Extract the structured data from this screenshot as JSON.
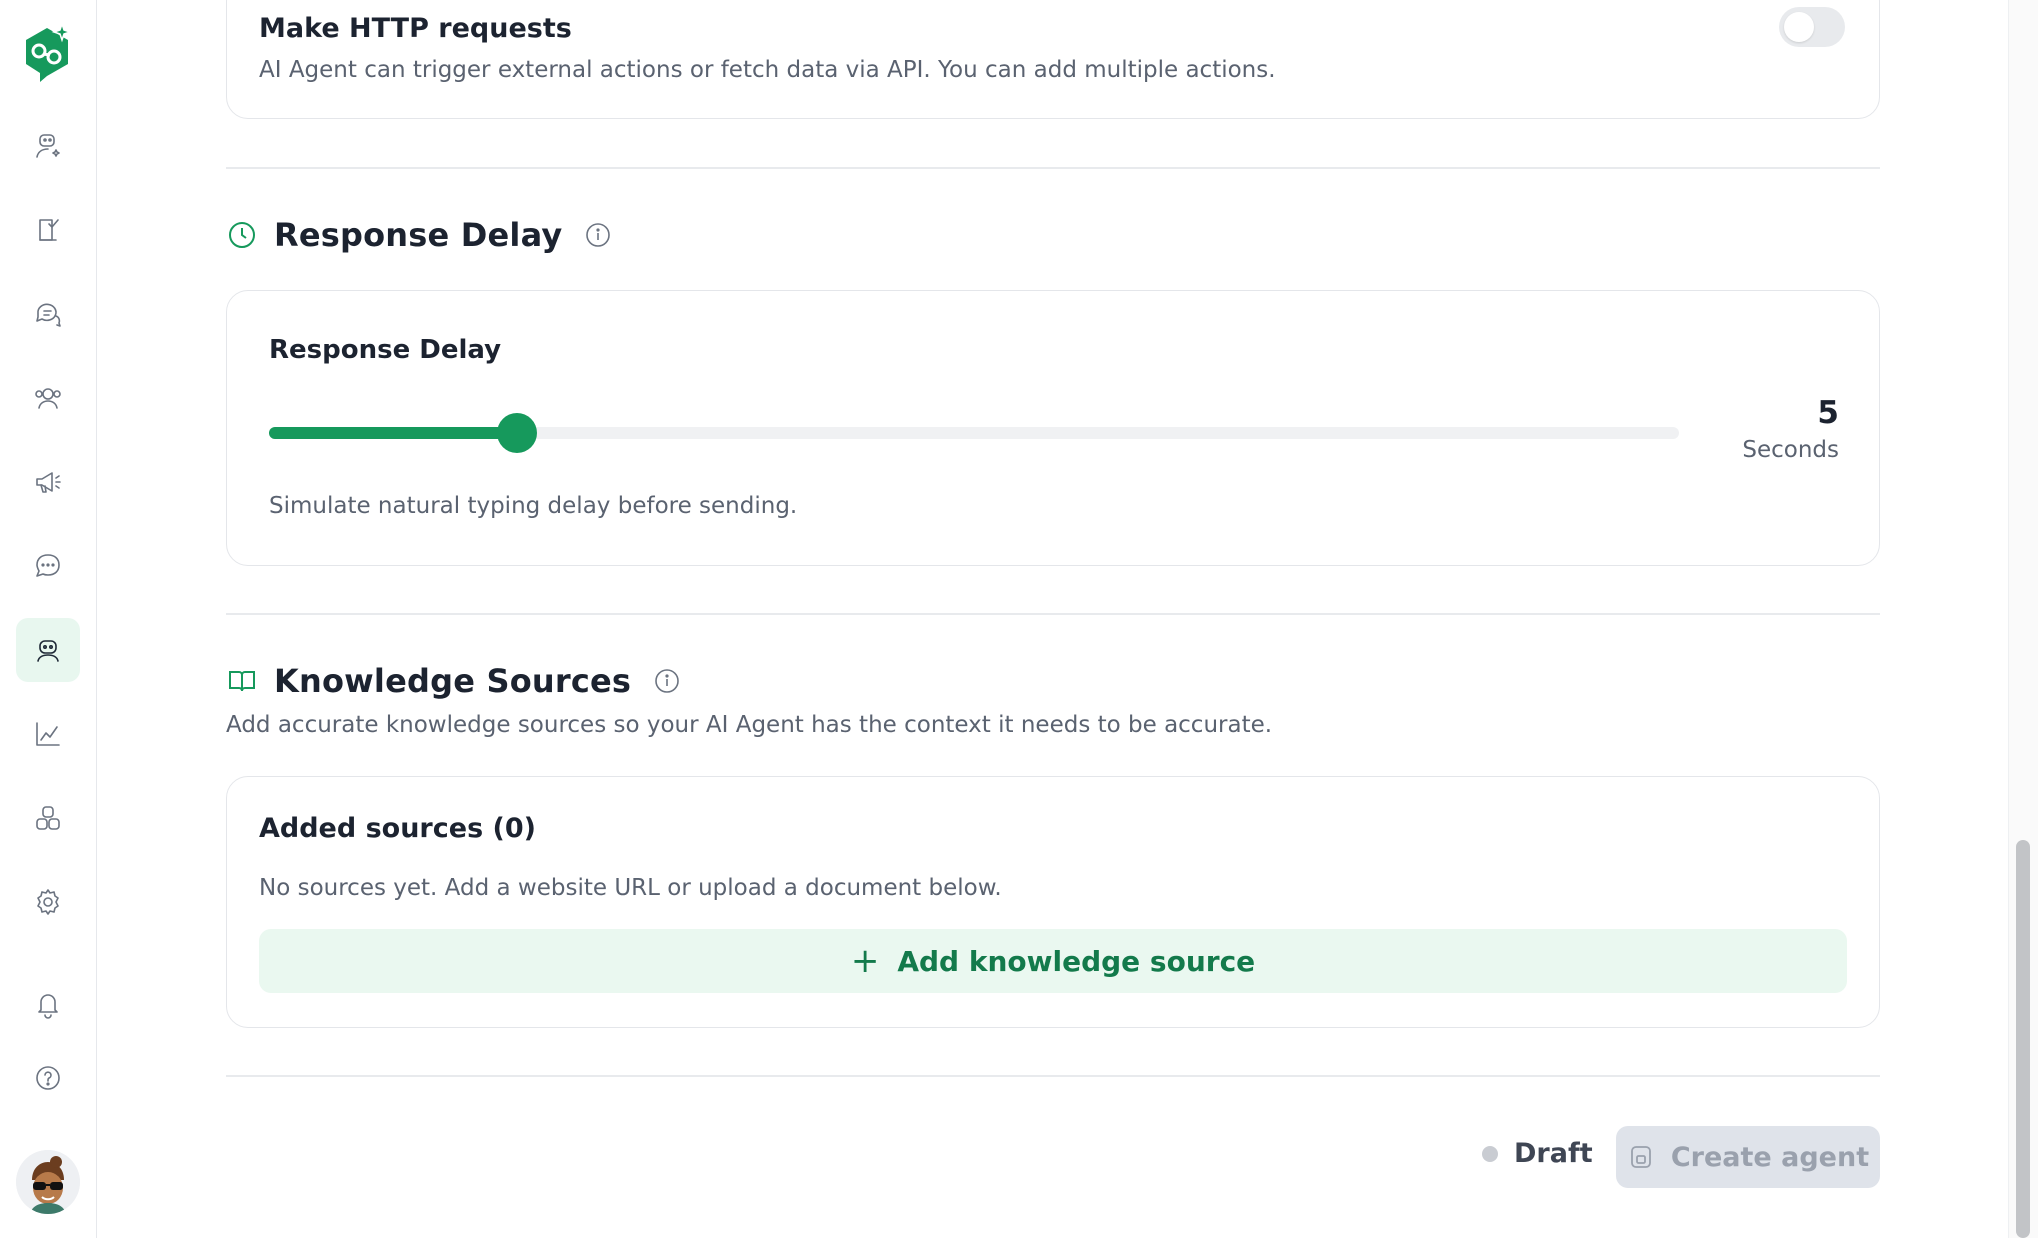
{
  "sidebar": {
    "logo": "agent-logo",
    "items": [
      {
        "name": "contacts-ai",
        "icon": "user-sparkle-icon"
      },
      {
        "name": "tasks",
        "icon": "clipboard-check-icon"
      },
      {
        "name": "conversations",
        "icon": "chat-bubbles-icon"
      },
      {
        "name": "team",
        "icon": "users-icon"
      },
      {
        "name": "campaigns",
        "icon": "megaphone-icon"
      },
      {
        "name": "messages",
        "icon": "chat-dots-icon"
      },
      {
        "name": "ai-agents",
        "icon": "robot-icon",
        "active": true
      },
      {
        "name": "analytics",
        "icon": "line-chart-icon"
      },
      {
        "name": "integrations",
        "icon": "blocks-icon"
      },
      {
        "name": "settings",
        "icon": "gear-icon"
      },
      {
        "name": "notifications",
        "icon": "bell-icon"
      },
      {
        "name": "help",
        "icon": "question-circle-icon"
      }
    ],
    "avatar": "user-avatar"
  },
  "http_card": {
    "title": "Make HTTP requests",
    "description": "AI Agent can trigger external actions or fetch data via API. You can add multiple actions.",
    "enabled": false
  },
  "response_delay_section": {
    "title": "Response Delay",
    "card_label": "Response Delay",
    "value": "5",
    "unit": "Seconds",
    "slider_fraction": 0.176,
    "hint": "Simulate natural typing delay before sending."
  },
  "knowledge_section": {
    "title": "Knowledge Sources",
    "subtitle": "Add accurate knowledge sources so your AI Agent has the context it needs to be accurate.",
    "added_title": "Added sources (0)",
    "empty_text": "No sources yet. Add a website URL or upload a document below.",
    "add_button": "Add knowledge source"
  },
  "footer": {
    "status": "Draft",
    "create_button": "Create agent"
  },
  "colors": {
    "accent": "#16995c",
    "accent_light": "#eaf8f0",
    "muted_text": "#5a6270"
  }
}
